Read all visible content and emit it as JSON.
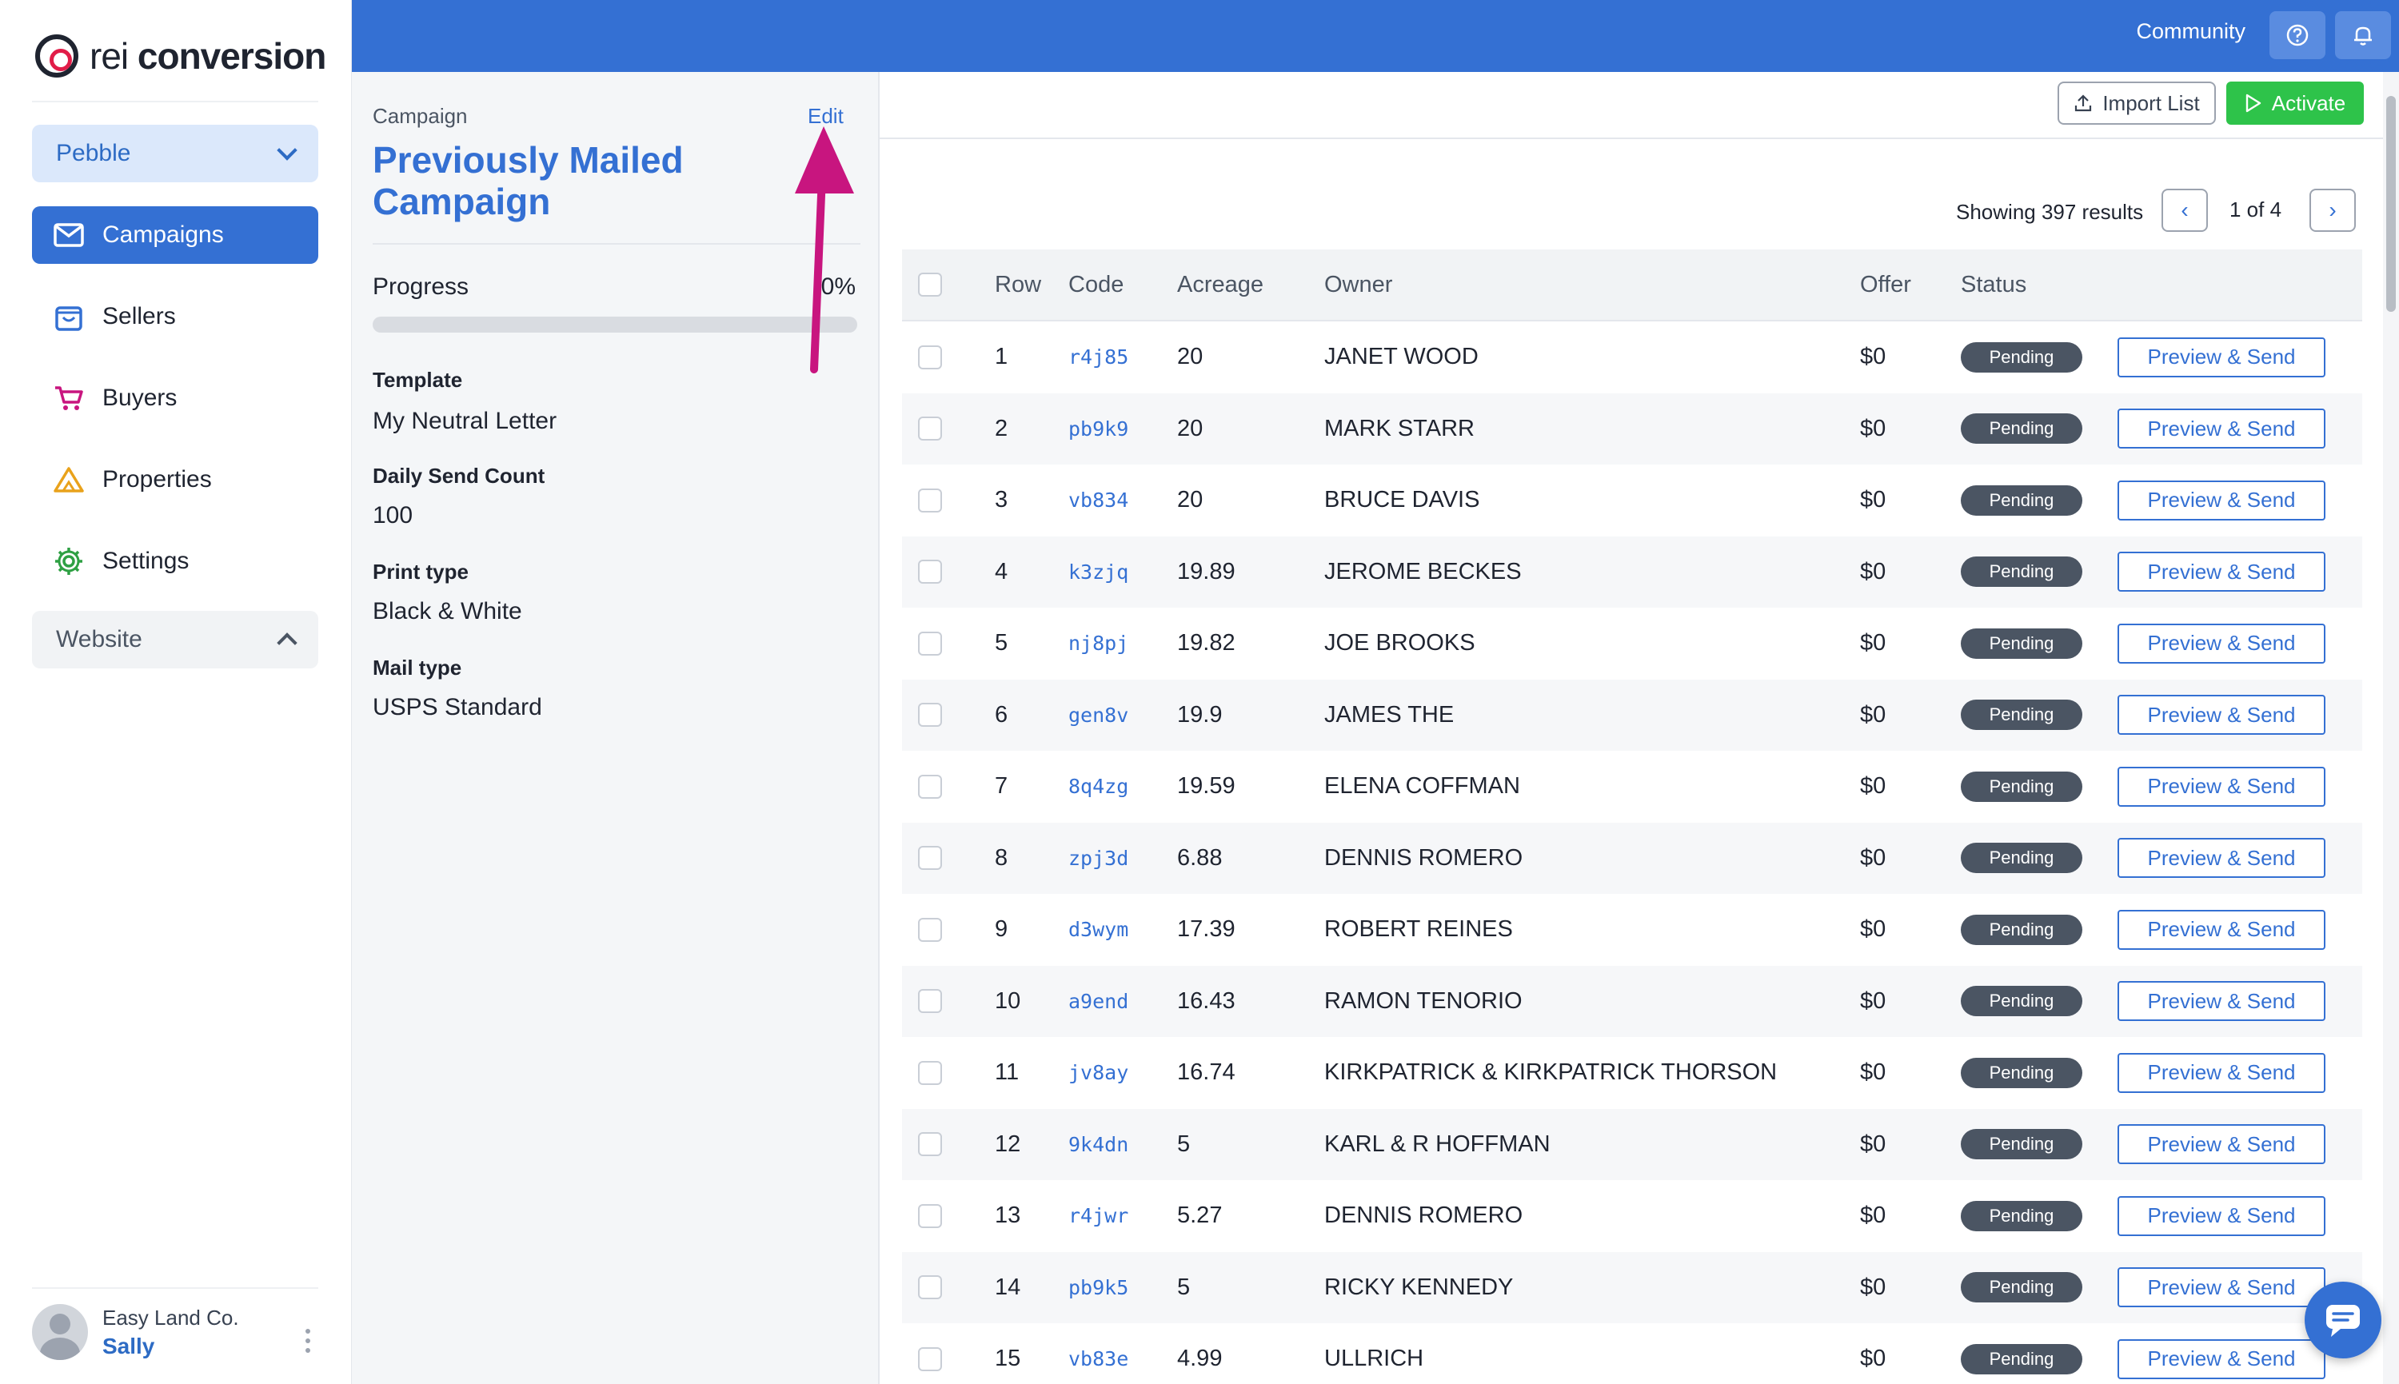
{
  "brand": {
    "name_light": "rei ",
    "name_bold": "conversion"
  },
  "sidebar": {
    "workspace": "Pebble",
    "items": [
      {
        "label": "Campaigns",
        "icon": "mail-icon",
        "active": true
      },
      {
        "label": "Sellers",
        "icon": "shopping-bag-icon"
      },
      {
        "label": "Buyers",
        "icon": "cart-icon"
      },
      {
        "label": "Properties",
        "icon": "warning-triangle-icon"
      },
      {
        "label": "Settings",
        "icon": "gear-icon"
      }
    ],
    "website": "Website",
    "user": {
      "company": "Easy Land Co.",
      "name": "Sally"
    }
  },
  "topbar": {
    "community": "Community",
    "icons": [
      "help-icon",
      "bell-icon"
    ]
  },
  "campaign": {
    "section_label": "Campaign",
    "edit": "Edit",
    "title": "Previously Mailed Campaign",
    "progress_label": "Progress",
    "progress_value": "0%",
    "progress_fraction": 0,
    "fields": [
      {
        "label": "Template",
        "value": "My Neutral Letter"
      },
      {
        "label": "Daily Send Count",
        "value": "100"
      },
      {
        "label": "Print type",
        "value": "Black & White"
      },
      {
        "label": "Mail type",
        "value": "USPS Standard"
      }
    ]
  },
  "toolbar": {
    "import": "Import List",
    "activate": "Activate"
  },
  "pagination": {
    "results": "Showing 397 results",
    "page": "1 of 4"
  },
  "table": {
    "headers": [
      "Row",
      "Code",
      "Acreage",
      "Owner",
      "Offer",
      "Status"
    ],
    "action_label": "Preview & Send",
    "rows": [
      {
        "row": "1",
        "code": "r4j85",
        "acreage": "20",
        "owner": "JANET WOOD",
        "offer": "$0",
        "status": "Pending"
      },
      {
        "row": "2",
        "code": "pb9k9",
        "acreage": "20",
        "owner": "MARK STARR",
        "offer": "$0",
        "status": "Pending"
      },
      {
        "row": "3",
        "code": "vb834",
        "acreage": "20",
        "owner": "BRUCE DAVIS",
        "offer": "$0",
        "status": "Pending"
      },
      {
        "row": "4",
        "code": "k3zjq",
        "acreage": "19.89",
        "owner": "JEROME BECKES",
        "offer": "$0",
        "status": "Pending"
      },
      {
        "row": "5",
        "code": "nj8pj",
        "acreage": "19.82",
        "owner": "JOE BROOKS",
        "offer": "$0",
        "status": "Pending"
      },
      {
        "row": "6",
        "code": "gen8v",
        "acreage": "19.9",
        "owner": "JAMES THE",
        "offer": "$0",
        "status": "Pending"
      },
      {
        "row": "7",
        "code": "8q4zg",
        "acreage": "19.59",
        "owner": "ELENA COFFMAN",
        "offer": "$0",
        "status": "Pending"
      },
      {
        "row": "8",
        "code": "zpj3d",
        "acreage": "6.88",
        "owner": "DENNIS ROMERO",
        "offer": "$0",
        "status": "Pending"
      },
      {
        "row": "9",
        "code": "d3wym",
        "acreage": "17.39",
        "owner": "ROBERT REINES",
        "offer": "$0",
        "status": "Pending"
      },
      {
        "row": "10",
        "code": "a9end",
        "acreage": "16.43",
        "owner": "RAMON TENORIO",
        "offer": "$0",
        "status": "Pending"
      },
      {
        "row": "11",
        "code": "jv8ay",
        "acreage": "16.74",
        "owner": "KIRKPATRICK & KIRKPATRICK THORSON",
        "offer": "$0",
        "status": "Pending"
      },
      {
        "row": "12",
        "code": "9k4dn",
        "acreage": "5",
        "owner": "KARL & R HOFFMAN",
        "offer": "$0",
        "status": "Pending"
      },
      {
        "row": "13",
        "code": "r4jwr",
        "acreage": "5.27",
        "owner": "DENNIS ROMERO",
        "offer": "$0",
        "status": "Pending"
      },
      {
        "row": "14",
        "code": "pb9k5",
        "acreage": "5",
        "owner": "RICKY KENNEDY",
        "offer": "$0",
        "status": "Pending"
      },
      {
        "row": "15",
        "code": "vb83e",
        "acreage": "4.99",
        "owner": "ULLRICH",
        "offer": "$0",
        "status": "Pending"
      }
    ]
  },
  "colors": {
    "brand_blue": "#3470d3",
    "activate_green": "#2ec34a",
    "annotation_arrow": "#c8157f",
    "badge_gray": "#4b5563"
  }
}
